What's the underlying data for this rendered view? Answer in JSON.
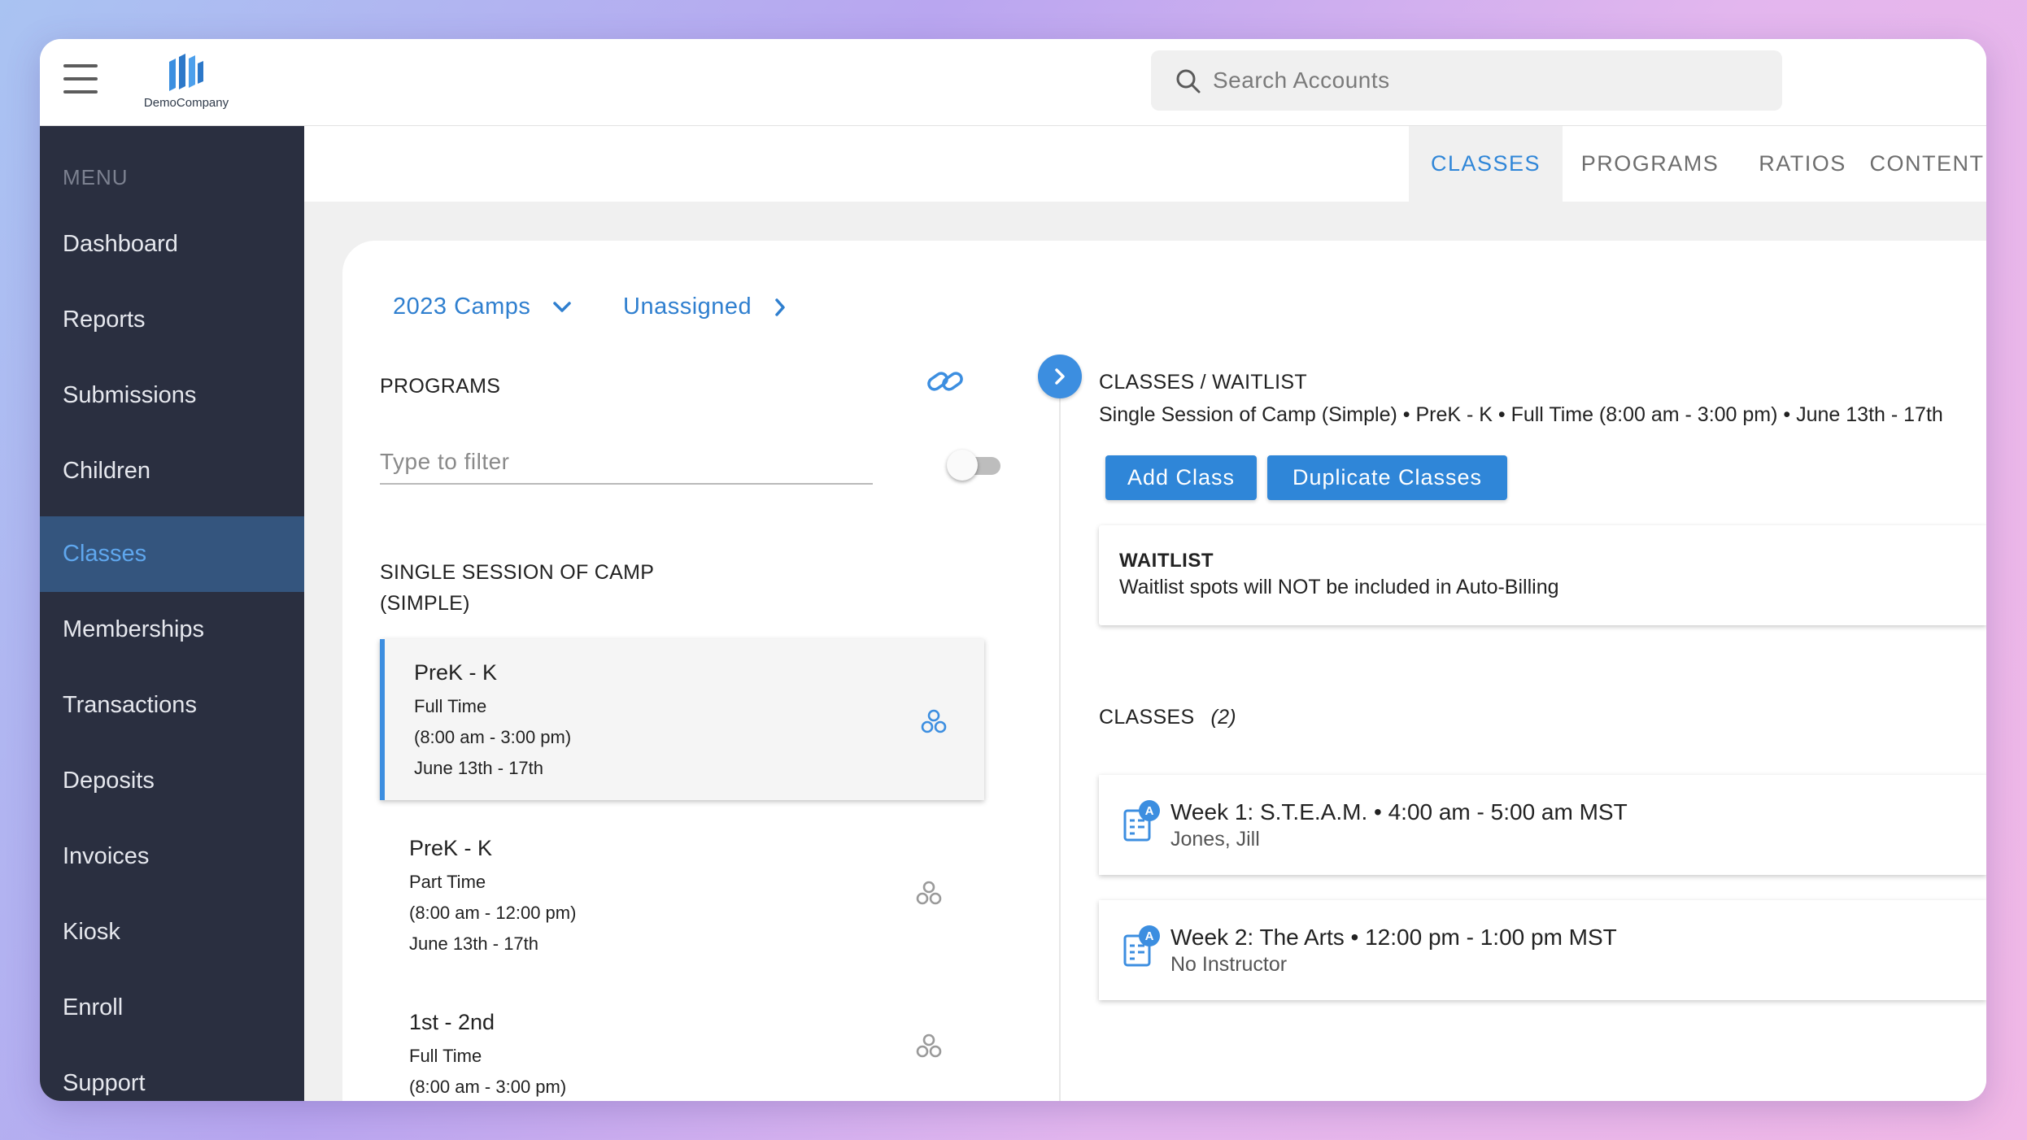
{
  "header": {
    "logo_text": "DemoCompany",
    "search_placeholder": "Search Accounts"
  },
  "sidebar": {
    "menu_label": "MENU",
    "items": [
      {
        "label": "Dashboard"
      },
      {
        "label": "Reports"
      },
      {
        "label": "Submissions"
      },
      {
        "label": "Children"
      },
      {
        "label": "Classes",
        "active": true
      },
      {
        "label": "Memberships"
      },
      {
        "label": "Transactions"
      },
      {
        "label": "Deposits"
      },
      {
        "label": "Invoices"
      },
      {
        "label": "Kiosk"
      },
      {
        "label": "Enroll"
      },
      {
        "label": "Support"
      }
    ]
  },
  "tabs": [
    {
      "label": "CLASSES",
      "active": true
    },
    {
      "label": "PROGRAMS"
    },
    {
      "label": "RATIOS"
    },
    {
      "label": "CONTENT"
    }
  ],
  "breadcrumb": {
    "season": "2023 Camps",
    "status": "Unassigned"
  },
  "programs": {
    "title": "PROGRAMS",
    "filter_placeholder": "Type to filter",
    "group_title": "SINGLE SESSION OF CAMP (SIMPLE)",
    "items": [
      {
        "name": "PreK - K",
        "type": "Full Time",
        "hours": "(8:00 am - 3:00 pm)",
        "dates": "June 13th - 17th",
        "selected": true
      },
      {
        "name": "PreK - K",
        "type": "Part Time",
        "hours": "(8:00 am - 12:00 pm)",
        "dates": "June 13th - 17th"
      },
      {
        "name": "1st - 2nd",
        "type": "Full Time",
        "hours": "(8:00 am - 3:00 pm)",
        "dates": ""
      }
    ]
  },
  "detail": {
    "title": "CLASSES / WAITLIST",
    "subtitle": "Single Session of Camp (Simple) • PreK - K • Full Time (8:00 am - 3:00 pm) • June 13th - 17th",
    "add_class_label": "Add Class",
    "duplicate_label": "Duplicate Classes",
    "waitlist_title": "WAITLIST",
    "waitlist_desc": "Waitlist spots will NOT be included in Auto-Billing",
    "classes_label": "CLASSES",
    "classes_count": "(2)",
    "classes": [
      {
        "title": "Week 1: S.T.E.A.M. • 4:00 am - 5:00 am MST",
        "instructor": "Jones, Jill"
      },
      {
        "title": "Week 2: The Arts • 12:00 pm - 1:00 pm MST",
        "instructor": "No Instructor"
      }
    ]
  },
  "colors": {
    "accent": "#2f86d8",
    "sidebar_bg": "#2a2f40",
    "sidebar_active_bg": "#34557e",
    "sidebar_active_text": "#5fa7ee"
  }
}
